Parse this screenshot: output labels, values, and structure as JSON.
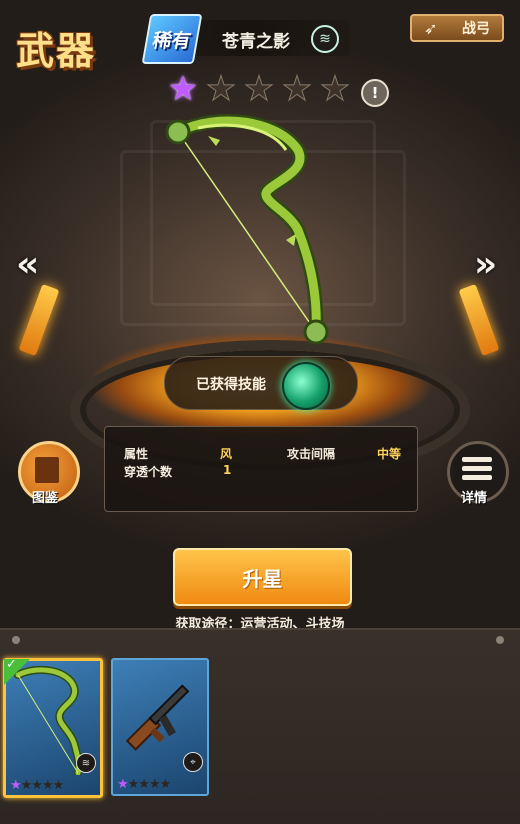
{
  "header": {
    "title": "武器",
    "rarity": "稀有",
    "weapon_name": "苍青之影",
    "element_icon": "wind-icon",
    "type_button_label": "战弓"
  },
  "weapon": {
    "star_rating": 1,
    "star_max": 5,
    "skill_label": "已获得技能",
    "stats": [
      {
        "label": "属性",
        "value": "风"
      },
      {
        "label": "攻击间隔",
        "value": "中等"
      },
      {
        "label": "穿透个数",
        "value": "1"
      }
    ]
  },
  "buttons": {
    "codex_label": "图鉴",
    "detail_label": "详情",
    "upgrade_label": "升星"
  },
  "source_text": "获取途径：运营活动、斗技场",
  "inventory": [
    {
      "name": "bow",
      "stars": 1,
      "element_icon": "wind-icon",
      "selected": true
    },
    {
      "name": "rifle",
      "stars": 1,
      "element_icon": "crosshair-icon",
      "selected": false
    }
  ],
  "colors": {
    "star_filled": "#c05cff",
    "accent_gold": "#ffc23a",
    "card_blue": "#3e7fb7"
  }
}
